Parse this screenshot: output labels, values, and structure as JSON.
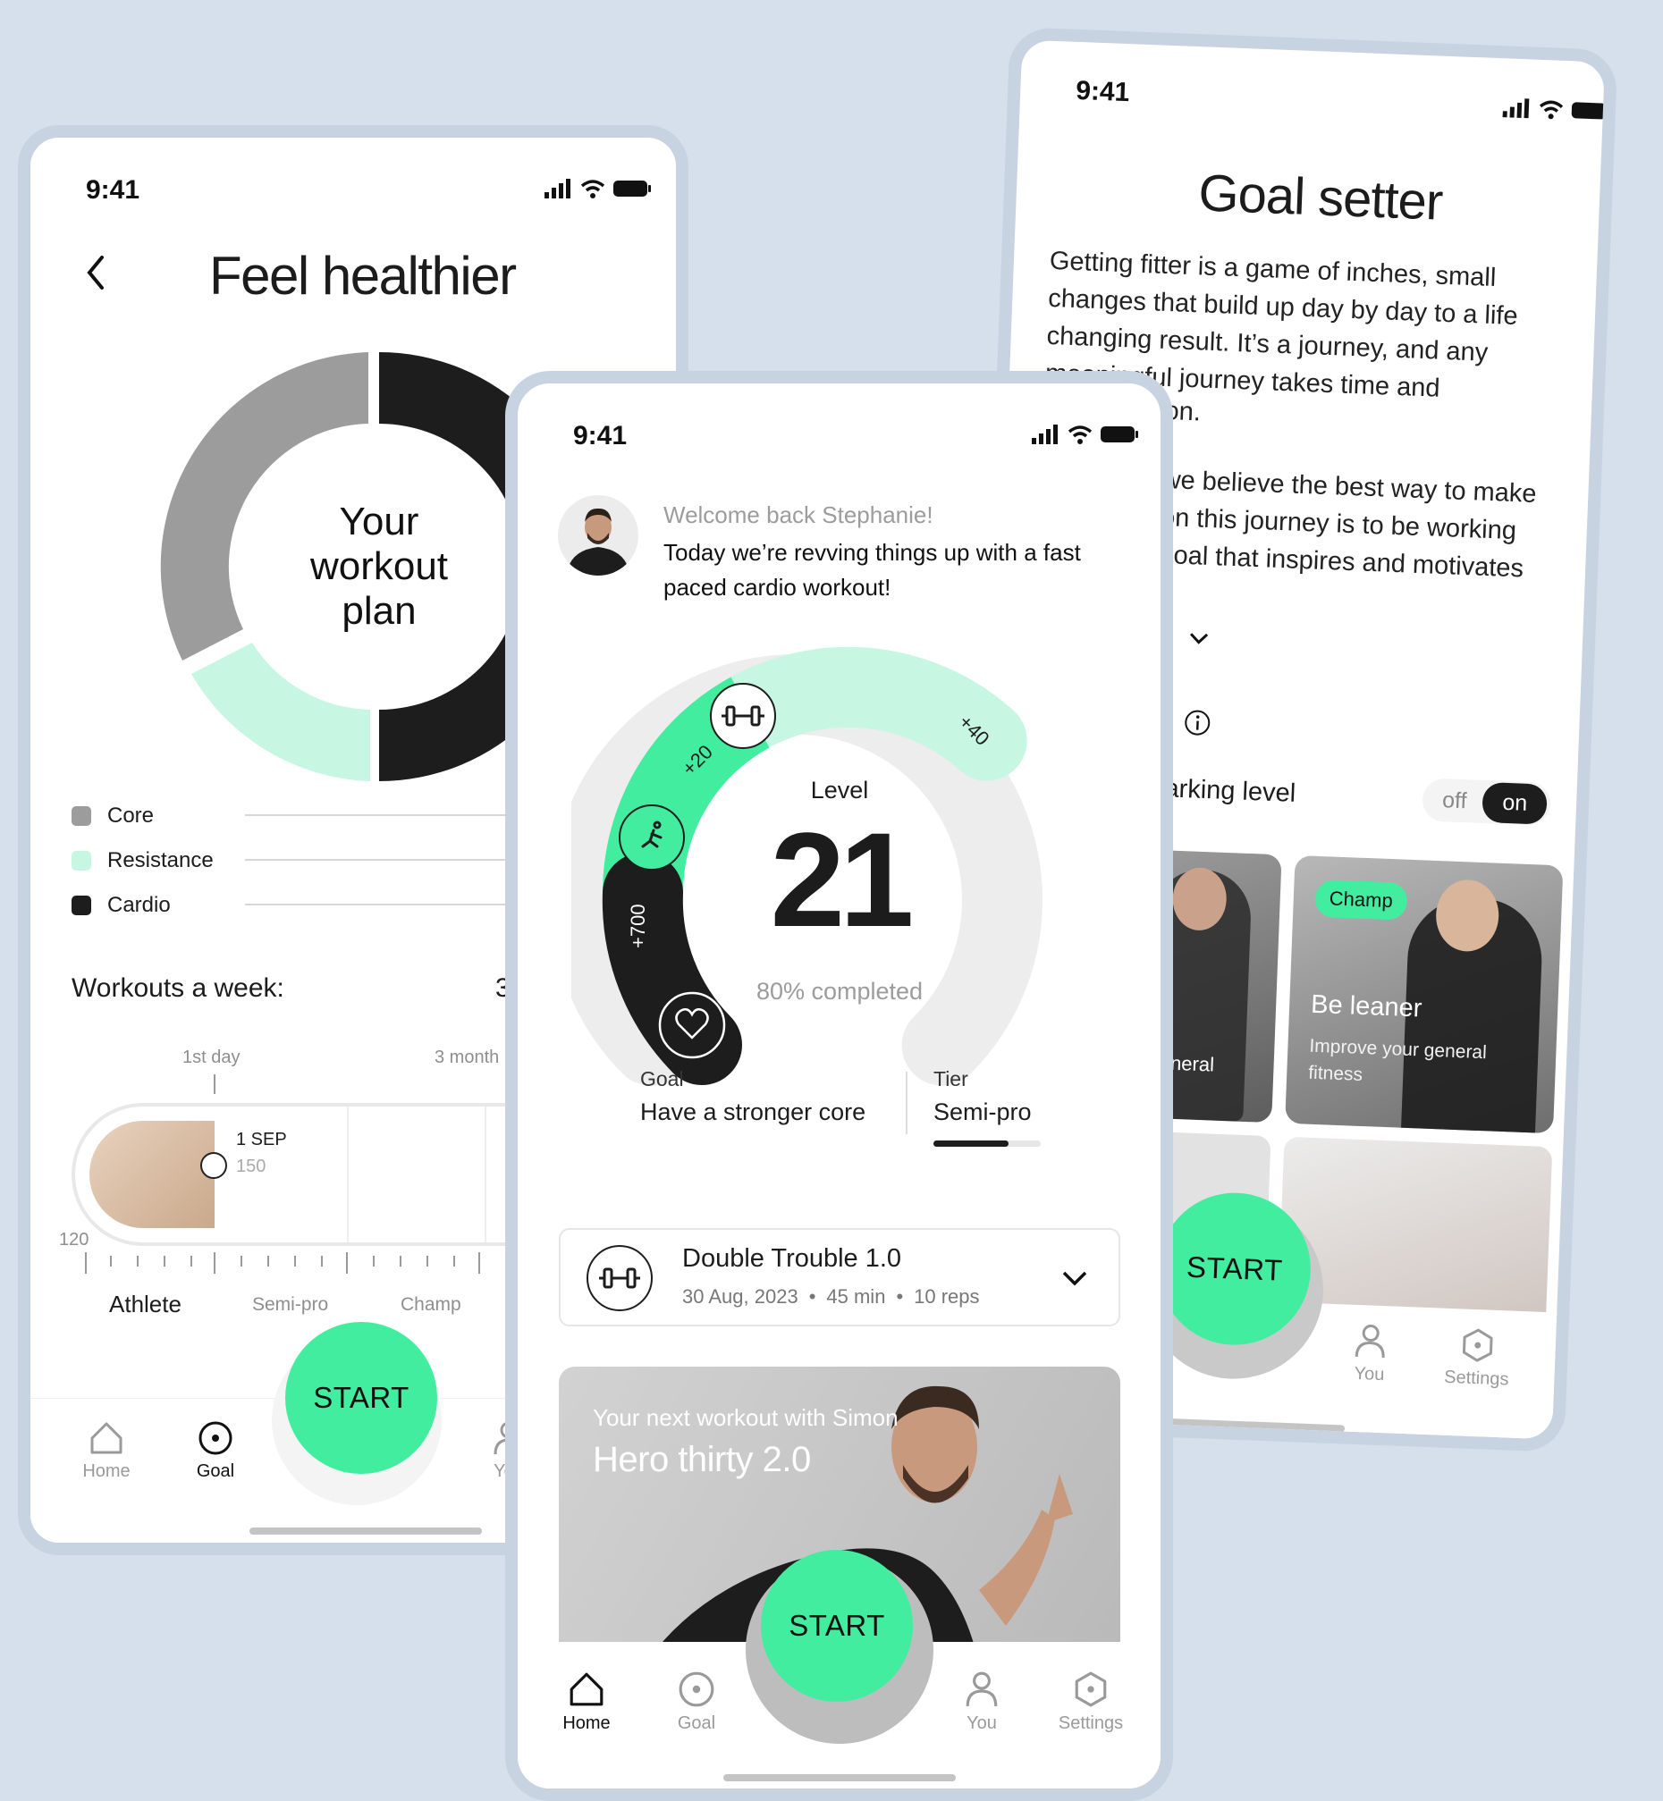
{
  "status": {
    "time": "9:41"
  },
  "left": {
    "title": "Feel healthier",
    "center_text": [
      "Your",
      "workout",
      "plan"
    ],
    "legend": [
      {
        "label": "Core",
        "color": "#9c9c9c"
      },
      {
        "label": "Resistance",
        "color": "#c7f7e2"
      },
      {
        "label": "Cardio",
        "color": "#1d1d1d"
      }
    ],
    "workouts_label": "Workouts a week:",
    "workouts_value": "3",
    "timeline_start": "1st day",
    "timeline_end": "3 month",
    "marker_date": "1 SEP",
    "marker_value": "150",
    "axis_min": "120",
    "tiers": [
      "Athlete",
      "Semi-pro",
      "Champ"
    ],
    "start": "START",
    "nav": {
      "home": "Home",
      "goal": "Goal",
      "you": "You"
    }
  },
  "middle": {
    "welcome": "Welcome back Stephanie!",
    "message": "Today we’re revving things up with a fast paced cardio workout!",
    "level_label": "Level",
    "level_value": "21",
    "progress_text": "80% completed",
    "progress": 0.8,
    "arc_labels": {
      "a": "+20",
      "b": "+40",
      "c": "+700"
    },
    "goal_label": "Goal",
    "goal_value": "Have a stronger core",
    "tier_label": "Tier",
    "tier_value": "Semi-pro",
    "workout": {
      "title": "Double Trouble 1.0",
      "date": "30 Aug, 2023",
      "duration": "45 min",
      "reps": "10 reps",
      "sep": "•"
    },
    "next": {
      "subtitle": "Your next workout with Simon",
      "title": "Hero thirty 2.0"
    },
    "start": "START",
    "nav": {
      "home": "Home",
      "goal": "Goal",
      "you": "You",
      "settings": "Settings"
    }
  },
  "right": {
    "title": "Goal setter",
    "para1": "Getting fitter is a game of inches, small changes that build up day by day to a life changing result. It’s a journey, and any meaningful journey takes time and",
    "para1_tail": "on.",
    "para2": [
      "we believe the best way to make",
      "on this journey is to be working",
      "goal that inspires and motivates"
    ],
    "collapsed_label": "e",
    "section_letter": "t",
    "toggle_label": "narking level",
    "toggle_off": "off",
    "toggle_on": "on",
    "card1_text": "general",
    "card2_badge": "Champ",
    "card2_title": "Be leaner",
    "card2_sub": "Improve your general fitness",
    "start": "START",
    "nav": {
      "you": "You",
      "settings": "Settings"
    }
  },
  "colors": {
    "accent": "#42eda0",
    "mint": "#c7f7e2",
    "dark": "#1d1d1d",
    "grey": "#9c9c9c"
  }
}
